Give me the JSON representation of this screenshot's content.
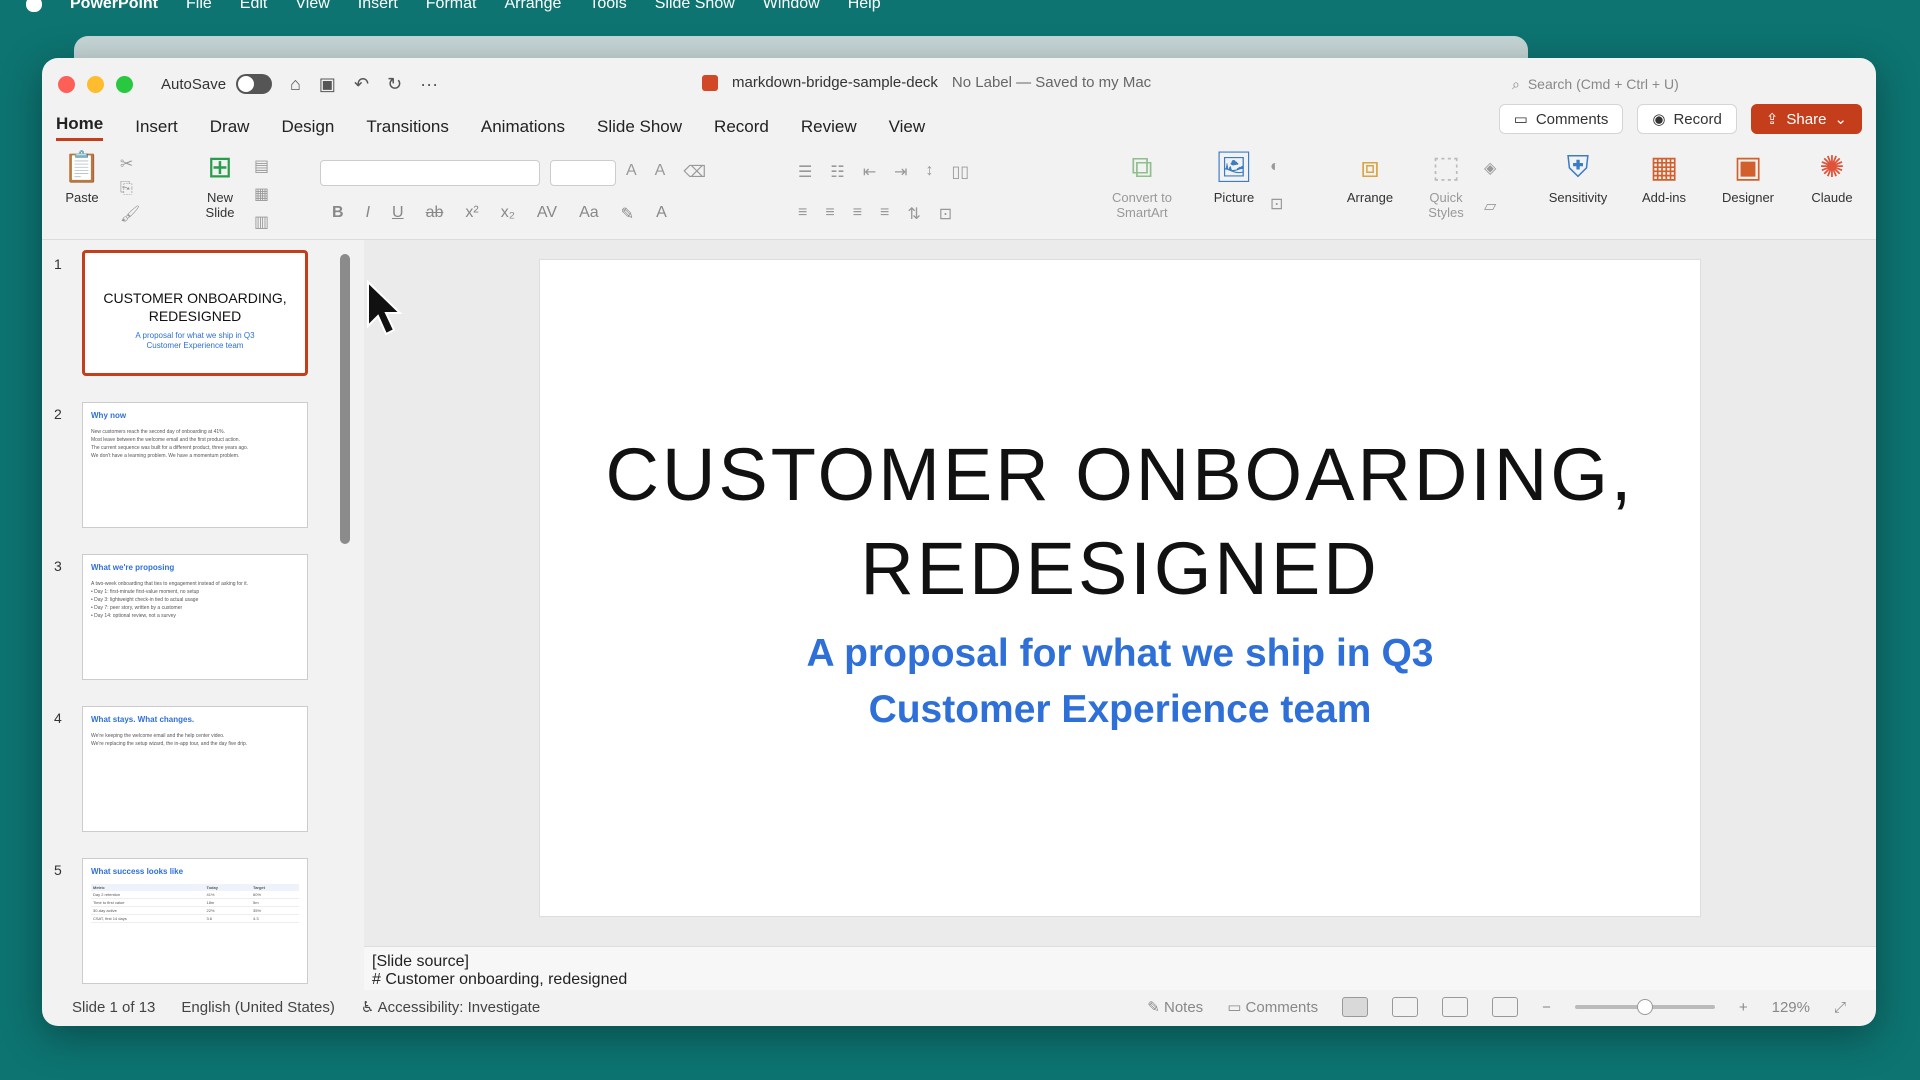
{
  "menubar": {
    "app": "PowerPoint",
    "items": [
      "File",
      "Edit",
      "View",
      "Insert",
      "Format",
      "Arrange",
      "Tools",
      "Slide Show",
      "Window",
      "Help"
    ]
  },
  "titlebar": {
    "autosave_label": "AutoSave",
    "doc_name": "markdown-bridge-sample-deck",
    "label_status": "No Label — Saved to my Mac",
    "search_placeholder": "Search (Cmd + Ctrl + U)"
  },
  "tabs": [
    "Home",
    "Insert",
    "Draw",
    "Design",
    "Transitions",
    "Animations",
    "Slide Show",
    "Record",
    "Review",
    "View"
  ],
  "active_tab": "Home",
  "ribbon_buttons": {
    "comments": "Comments",
    "record": "Record",
    "share": "Share"
  },
  "ribbon": {
    "paste": "Paste",
    "new_slide": "New Slide",
    "convert_smartart": "Convert to SmartArt",
    "picture": "Picture",
    "arrange": "Arrange",
    "quick_styles": "Quick Styles",
    "sensitivity": "Sensitivity",
    "add_ins": "Add-ins",
    "designer": "Designer",
    "claude": "Claude"
  },
  "thumbnails": [
    {
      "num": "1",
      "title": "CUSTOMER ONBOARDING, REDESIGNED",
      "sub": [
        "A proposal for what we ship in Q3",
        "Customer Experience team"
      ]
    },
    {
      "num": "2",
      "title": "Why now",
      "lines": [
        "New customers reach the second day of onboarding at 41%.",
        "Most leave between the welcome email and the first product action.",
        "The current sequence was built for a different product, three years ago.",
        "We don't have a learning problem. We have a momentum problem."
      ]
    },
    {
      "num": "3",
      "title": "What we're proposing",
      "lines": [
        "A two-week onboarding that ties to engagement instead of asking for it.",
        "• Day 1: first-minute first-value moment, no setup",
        "• Day 3: lightweight check-in tied to actual usage",
        "• Day 7: peer story, written by a customer",
        "• Day 14: optional review, not a survey"
      ]
    },
    {
      "num": "4",
      "title": "What stays. What changes.",
      "lines": [
        "We're keeping the welcome email and the help center video.",
        "We're replacing the setup wizard, the in-app tour, and the day five drip."
      ]
    },
    {
      "num": "5",
      "title": "What success looks like",
      "table": {
        "headers": [
          "Metric",
          "Today",
          "Target"
        ],
        "rows": [
          [
            "Day 2 retention",
            "41%",
            "60%"
          ],
          [
            "Time to first value",
            "18m",
            "5m"
          ],
          [
            "30-day active",
            "22%",
            "35%"
          ],
          [
            "CSAT, first 14 days",
            "3.6",
            "4.3"
          ]
        ]
      }
    }
  ],
  "slide": {
    "title_lines": [
      "CUSTOMER ONBOARDING,",
      "REDESIGNED"
    ],
    "subtitle_lines": [
      "A proposal for what we ship in Q3",
      "Customer Experience team"
    ]
  },
  "notes": {
    "line1": "[Slide source]",
    "line2": "# Customer onboarding, redesigned"
  },
  "statusbar": {
    "slide_count": "Slide 1 of 13",
    "language": "English (United States)",
    "accessibility": "Accessibility: Investigate",
    "notes": "Notes",
    "comments": "Comments",
    "zoom": "129%",
    "zoom_level": 0.5
  },
  "colors": {
    "desktop": "#0d7471",
    "accent": "#c43e1c",
    "subtitle": "#2e6fd8"
  }
}
